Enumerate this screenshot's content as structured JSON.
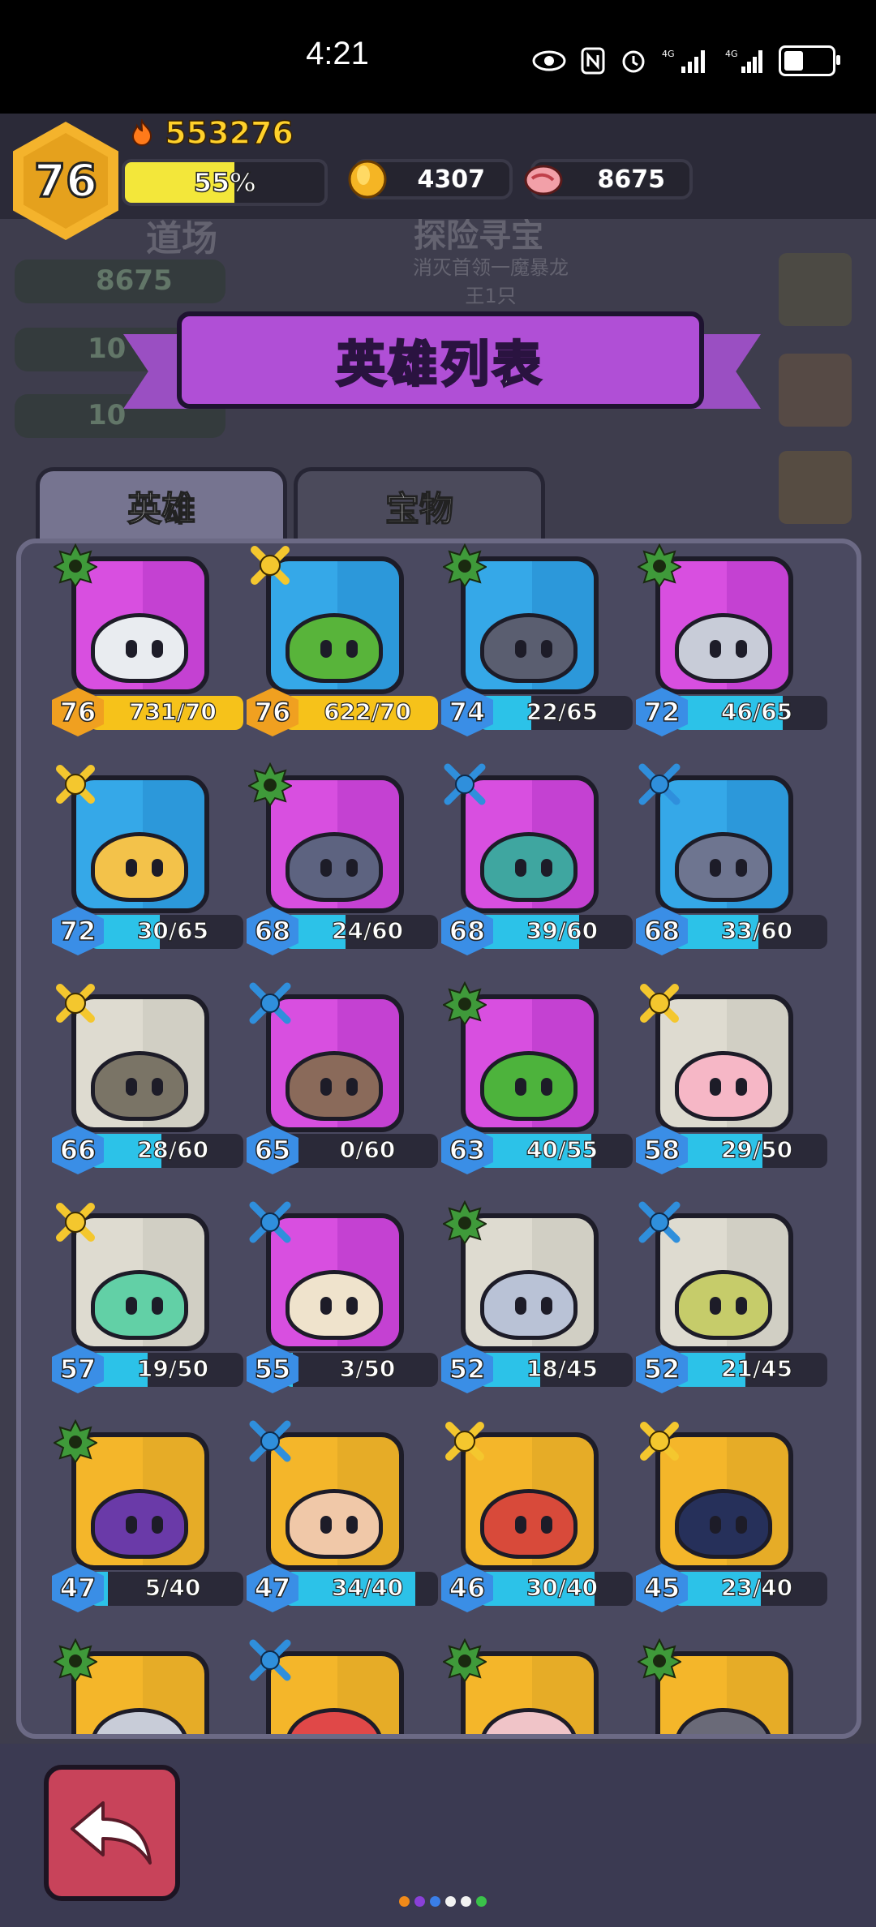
{
  "status_bar": {
    "time": "4:21",
    "network": "4G"
  },
  "header": {
    "level": "76",
    "power": "553276",
    "xp_percent_text": "55%",
    "xp_fraction": 0.55,
    "gold": "4307",
    "meat": "8675"
  },
  "background_labels": {
    "dojo": "道场",
    "adventure": "探险寻宝",
    "meat_left": "8675",
    "wood_left": "10",
    "ore_left": "10",
    "quest": "消灭首领一魔暴龙王1只"
  },
  "title": "英雄列表",
  "tabs": [
    {
      "label": "英雄",
      "active": true
    },
    {
      "label": "宝物",
      "active": false
    }
  ],
  "colors": {
    "gold_bar": "#f6c21a",
    "cyan_bar": "#2cc2e8",
    "green_badge": "#3f9a3a",
    "yellow_badge": "#f4c72e",
    "blue_badge": "#2f8fdc"
  },
  "heroes": [
    {
      "level": "76",
      "progress": "731/70",
      "fraction": 1.0,
      "bar": "gold",
      "badge": "green",
      "bg": "#d84fe0",
      "face": "#e9ecf0"
    },
    {
      "level": "76",
      "progress": "622/70",
      "fraction": 1.0,
      "bar": "gold",
      "badge": "yellow",
      "bg": "#35a8e8",
      "face": "#58b43a"
    },
    {
      "level": "74",
      "progress": "22/65",
      "fraction": 0.34,
      "bar": "cyan",
      "badge": "green",
      "bg": "#35a8e8",
      "face": "#5a5e70"
    },
    {
      "level": "72",
      "progress": "46/65",
      "fraction": 0.71,
      "bar": "cyan",
      "badge": "green",
      "bg": "#d84fe0",
      "face": "#c8ccd8"
    },
    {
      "level": "72",
      "progress": "30/65",
      "fraction": 0.46,
      "bar": "cyan",
      "badge": "yellow",
      "bg": "#35a8e8",
      "face": "#f3c24a"
    },
    {
      "level": "68",
      "progress": "24/60",
      "fraction": 0.4,
      "bar": "cyan",
      "badge": "green",
      "bg": "#d84fe0",
      "face": "#5d6380"
    },
    {
      "level": "68",
      "progress": "39/60",
      "fraction": 0.65,
      "bar": "cyan",
      "badge": "blue",
      "bg": "#d84fe0",
      "face": "#3fa6a0"
    },
    {
      "level": "68",
      "progress": "33/60",
      "fraction": 0.55,
      "bar": "cyan",
      "badge": "blue",
      "bg": "#35a8e8",
      "face": "#6e7590"
    },
    {
      "level": "66",
      "progress": "28/60",
      "fraction": 0.47,
      "bar": "cyan",
      "badge": "yellow",
      "bg": "#dedbd0",
      "face": "#7a7466"
    },
    {
      "level": "65",
      "progress": "0/60",
      "fraction": 0.0,
      "bar": "cyan",
      "badge": "blue",
      "bg": "#d84fe0",
      "face": "#8a6a5a"
    },
    {
      "level": "63",
      "progress": "40/55",
      "fraction": 0.73,
      "bar": "cyan",
      "badge": "green",
      "bg": "#d84fe0",
      "face": "#4db33c"
    },
    {
      "level": "58",
      "progress": "29/50",
      "fraction": 0.58,
      "bar": "cyan",
      "badge": "yellow",
      "bg": "#dedbd0",
      "face": "#f6b7c6"
    },
    {
      "level": "57",
      "progress": "19/50",
      "fraction": 0.38,
      "bar": "cyan",
      "badge": "yellow",
      "bg": "#dedbd0",
      "face": "#62d0a6"
    },
    {
      "level": "55",
      "progress": "3/50",
      "fraction": 0.06,
      "bar": "cyan",
      "badge": "blue",
      "bg": "#d84fe0",
      "face": "#efe3cc"
    },
    {
      "level": "52",
      "progress": "18/45",
      "fraction": 0.4,
      "bar": "cyan",
      "badge": "green",
      "bg": "#dedbd0",
      "face": "#b9c2d6"
    },
    {
      "level": "52",
      "progress": "21/45",
      "fraction": 0.47,
      "bar": "cyan",
      "badge": "blue",
      "bg": "#dedbd0",
      "face": "#c6cc6a"
    },
    {
      "level": "47",
      "progress": "5/40",
      "fraction": 0.12,
      "bar": "cyan",
      "badge": "green",
      "bg": "#f4b62a",
      "face": "#6a3aa8"
    },
    {
      "level": "47",
      "progress": "34/40",
      "fraction": 0.85,
      "bar": "cyan",
      "badge": "blue",
      "bg": "#f4b62a",
      "face": "#f0c8a8"
    },
    {
      "level": "46",
      "progress": "30/40",
      "fraction": 0.75,
      "bar": "cyan",
      "badge": "yellow",
      "bg": "#f4b62a",
      "face": "#d84a3a"
    },
    {
      "level": "45",
      "progress": "23/40",
      "fraction": 0.57,
      "bar": "cyan",
      "badge": "yellow",
      "bg": "#f4b62a",
      "face": "#26305a"
    },
    {
      "level": "",
      "progress": "",
      "fraction": 0,
      "bar": "cyan",
      "badge": "green",
      "bg": "#f4b62a",
      "face": "#c8ccd8"
    },
    {
      "level": "",
      "progress": "",
      "fraction": 0,
      "bar": "cyan",
      "badge": "blue",
      "bg": "#f4b62a",
      "face": "#e04848"
    },
    {
      "level": "",
      "progress": "",
      "fraction": 0,
      "bar": "cyan",
      "badge": "green",
      "bg": "#f4b62a",
      "face": "#f0c4c8"
    },
    {
      "level": "",
      "progress": "",
      "fraction": 0,
      "bar": "cyan",
      "badge": "green",
      "bg": "#f4b62a",
      "face": "#6a6a78"
    }
  ],
  "page_dots": [
    "#f08a1a",
    "#8a40d8",
    "#3a7ee8",
    "#f2f2f2",
    "#f2f2f2",
    "#3ac24a"
  ],
  "icons": {
    "back": "back-arrow-icon",
    "gold": "gold-coin-icon",
    "meat": "meat-icon",
    "flame": "flame-icon"
  }
}
